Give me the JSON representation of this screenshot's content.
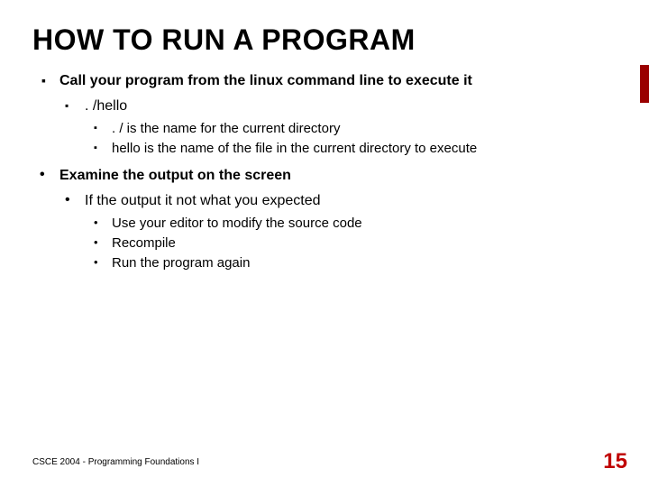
{
  "title": "HOW TO RUN A PROGRAM",
  "b1": {
    "a": "Call your program from the linux command line to execute it",
    "a1": ". /hello",
    "a1a": ". / is the name for the current directory",
    "a1b": "hello is the name of the file in the current directory to execute",
    "b": "Examine the output on the screen",
    "b1": "If the output it not what you expected",
    "b1a": "Use your editor to modify the source code",
    "b1b": "Recompile",
    "b1c": "Run the program again"
  },
  "footer": "CSCE 2004 - Programming Foundations I",
  "page": "15"
}
